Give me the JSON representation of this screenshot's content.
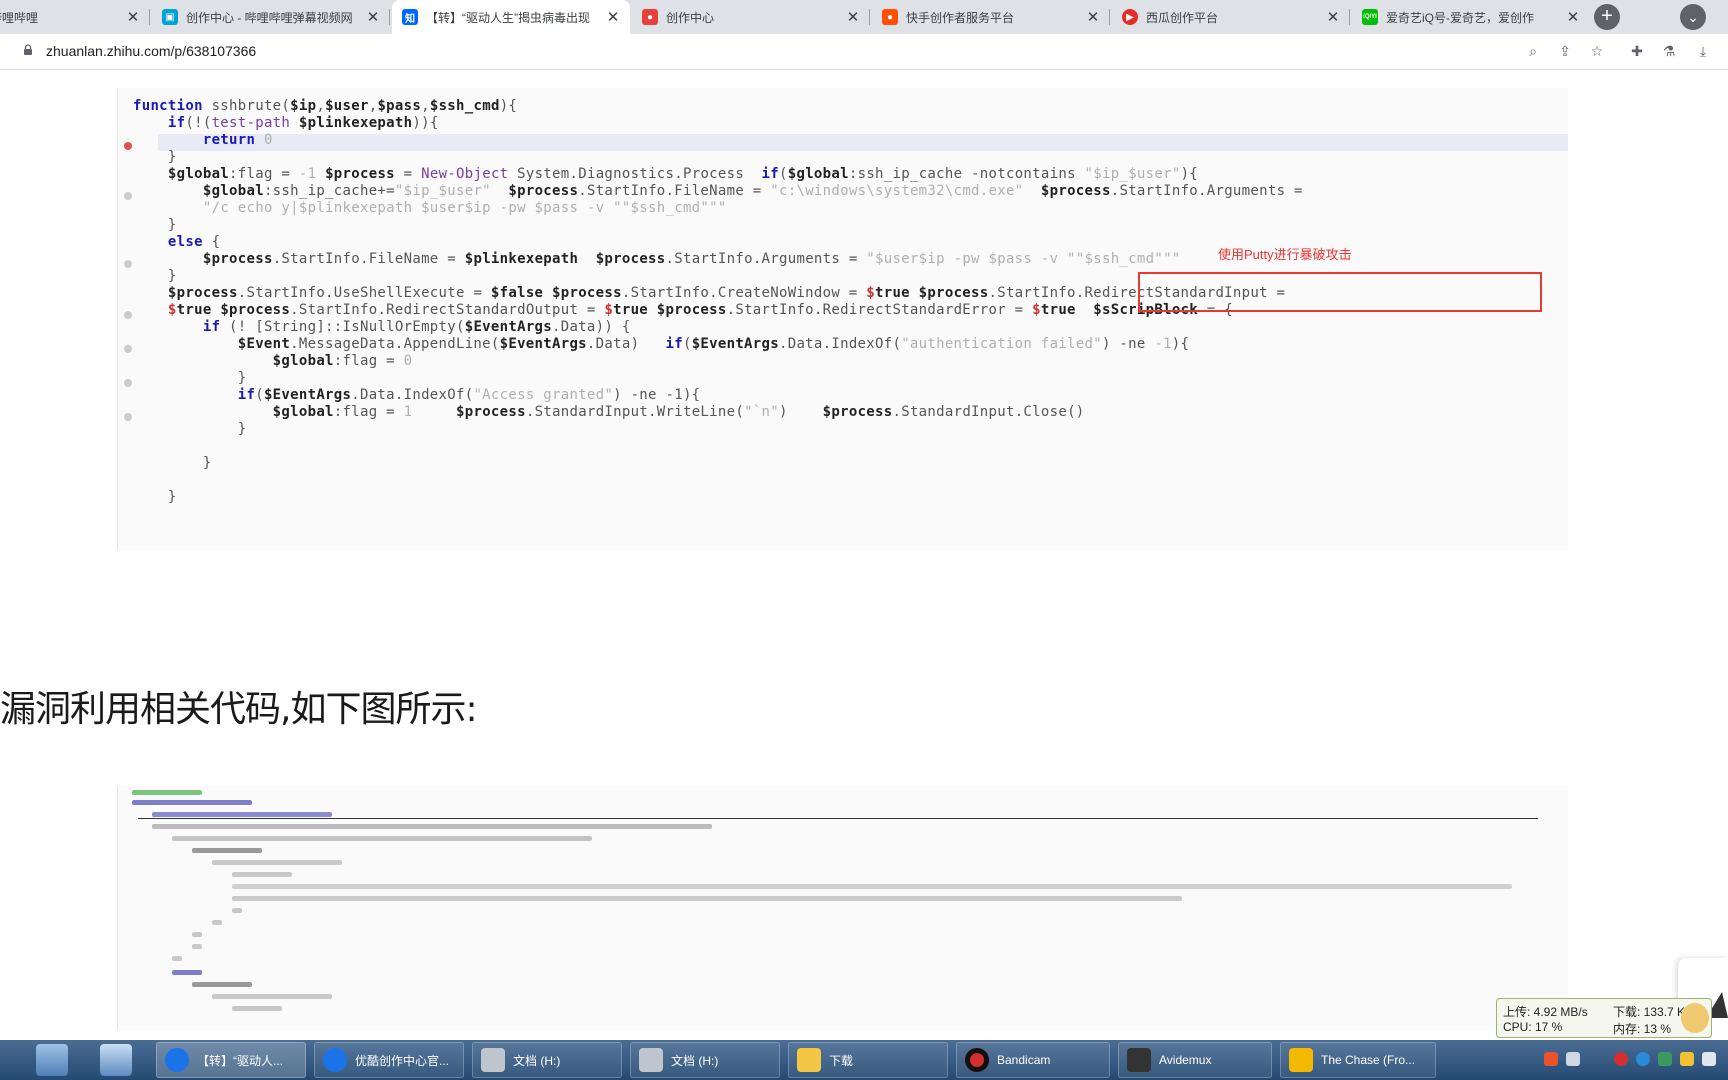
{
  "browser": {
    "tabs": [
      {
        "title": "哔哩哔哩",
        "active": false,
        "favicon_color": "#fb7299",
        "favicon_glyph": ""
      },
      {
        "title": "创作中心 - 哔哩哔哩弹幕视频网",
        "active": false,
        "favicon_color": "#00a1d6",
        "favicon_glyph": "tv-icon"
      },
      {
        "title": "【转】“驱动人生”揭虫病毒出现",
        "active": true,
        "favicon_color": "#0066ff",
        "favicon_glyph": "知"
      },
      {
        "title": "创作中心",
        "active": false,
        "favicon_color": "#e8413a",
        "favicon_glyph": ""
      },
      {
        "title": "快手创作者服务平台",
        "active": false,
        "favicon_color": "#ff5000",
        "favicon_glyph": ""
      },
      {
        "title": "西瓜创作平台",
        "active": false,
        "favicon_color": "#e52d27",
        "favicon_glyph": ""
      },
      {
        "title": "爱奇艺iQ号-爱奇艺，爱创作",
        "active": false,
        "favicon_color": "#00be06",
        "favicon_glyph": "iQIYI"
      }
    ],
    "new_tab_label": "+",
    "url": "zhuanlan.zhihu.com/p/638107366"
  },
  "article": {
    "code_annotation": "使用Putty进行暴破攻击",
    "heading": "漏洞利用相关代码,如下图所示:"
  },
  "status_widget": {
    "upload": "上传: 4.92 MB/s",
    "download": "下载: 133.7 KB/s",
    "cpu": "CPU: 17 %",
    "memory": "内存: 13 %"
  },
  "taskbar": {
    "buttons": [
      {
        "label": "【转】“驱动人...",
        "icon_color": "#1a73e8",
        "active": true
      },
      {
        "label": "优酷创作中心官...",
        "icon_color": "#1a73e8",
        "active": false
      },
      {
        "label": "文档 (H:)",
        "icon_color": "#bfc5cc",
        "active": false
      },
      {
        "label": "文档 (H:)",
        "icon_color": "#bfc5cc",
        "active": false
      },
      {
        "label": "下载",
        "icon_color": "#f3c744",
        "active": false
      },
      {
        "label": "Bandicam",
        "icon_color": "#d32f2f",
        "active": false
      },
      {
        "label": "Avidemux",
        "icon_color": "#333333",
        "active": false
      },
      {
        "label": "The Chase (Fro...",
        "icon_color": "#f5b800",
        "active": false
      }
    ]
  }
}
